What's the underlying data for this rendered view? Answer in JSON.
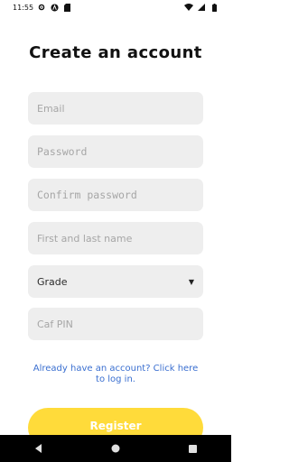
{
  "status_bar": {
    "time": "11:55",
    "icons_left": [
      "gear-icon",
      "a-circle-icon",
      "sd-card-icon"
    ],
    "icons_right": [
      "wifi-icon",
      "cellular-signal-icon",
      "battery-icon"
    ]
  },
  "page": {
    "title": "Create an account"
  },
  "form": {
    "email_placeholder": "Email",
    "password_placeholder": "Password",
    "confirm_password_placeholder": "Confirm password",
    "full_name_placeholder": "First and last name",
    "grade_value": "Grade",
    "caf_pin_placeholder": "Caf PIN"
  },
  "login_link": "Already have an account? Click here to log in.",
  "register_button": "Register",
  "colors": {
    "accent": "#ffdb3a",
    "link": "#3a6fd0",
    "field_bg": "#eeeeee"
  },
  "nav": [
    "back-icon",
    "home-icon",
    "recents-icon"
  ]
}
